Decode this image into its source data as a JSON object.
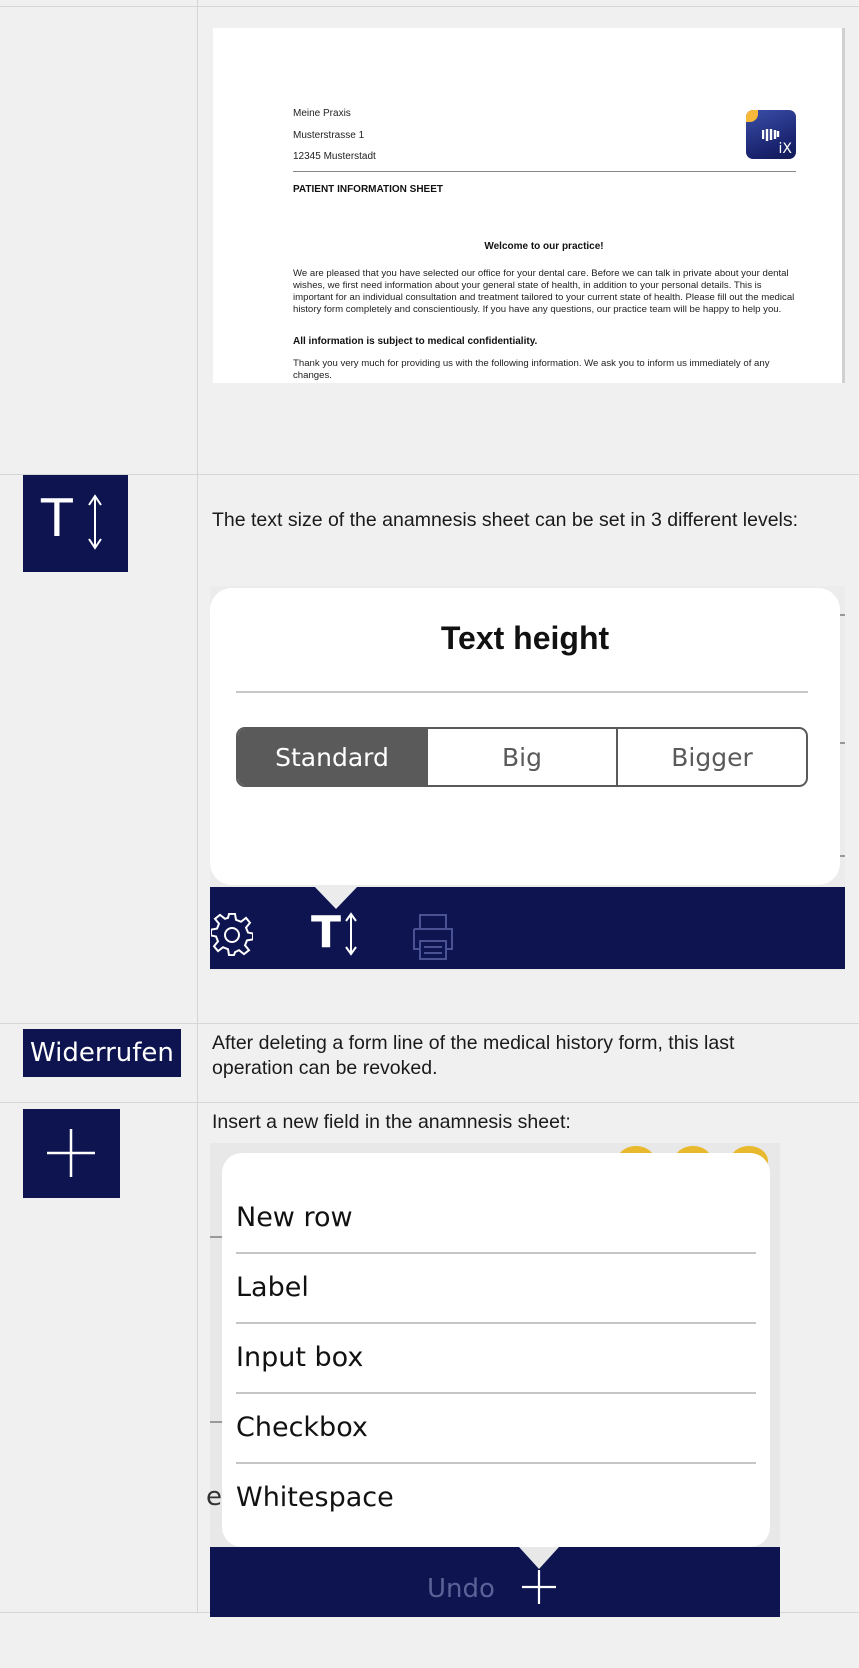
{
  "doc_preview": {
    "address_line1": "Meine Praxis",
    "address_line2": "Musterstrasse  1",
    "address_line3": "12345 Musterstadt",
    "logo_text": "iX",
    "sheet_title": "PATIENT INFORMATION SHEET",
    "welcome": "Welcome to our practice!",
    "paragraph1": "We are pleased that you have selected our office for your dental care. Before we can talk in private about your dental wishes, we first need information about your general state of health, in addition to your personal details. This is important for an individual consultation and treatment tailored to your current state of health. Please fill out the medical history form completely and conscientiously. If you have any questions, our practice team will be happy to help you.",
    "confidential": "All information is subject to medical confidentiality.",
    "paragraph2": "Thank you very much for providing us with the following information. We ask you to inform us immediately of any changes."
  },
  "text_size_row": {
    "icon": "text-height-icon",
    "description": "The text size of the anamnesis sheet can be set in 3 different levels:",
    "popover_title": "Text height",
    "options": [
      "Standard",
      "Big",
      "Bigger"
    ],
    "selected": "Standard",
    "toolbar_icons": [
      "gear-icon",
      "text-height-icon",
      "printer-icon"
    ]
  },
  "undo_row": {
    "button_label": "Widerrufen",
    "description": "After deleting a form line of the medical history form, this last operation can be revoked."
  },
  "insert_row": {
    "icon": "plus-icon",
    "description": "Insert a new field in the anamnesis sheet:",
    "menu_items": [
      "New row",
      "Label",
      "Input box",
      "Checkbox",
      "Whitespace"
    ],
    "cut_off_text": "e:",
    "toolbar_undo": "Undo"
  },
  "colors": {
    "navy": "#0d1450",
    "segment_active": "#5a5a5a",
    "accent_yellow": "#e8b92c"
  }
}
